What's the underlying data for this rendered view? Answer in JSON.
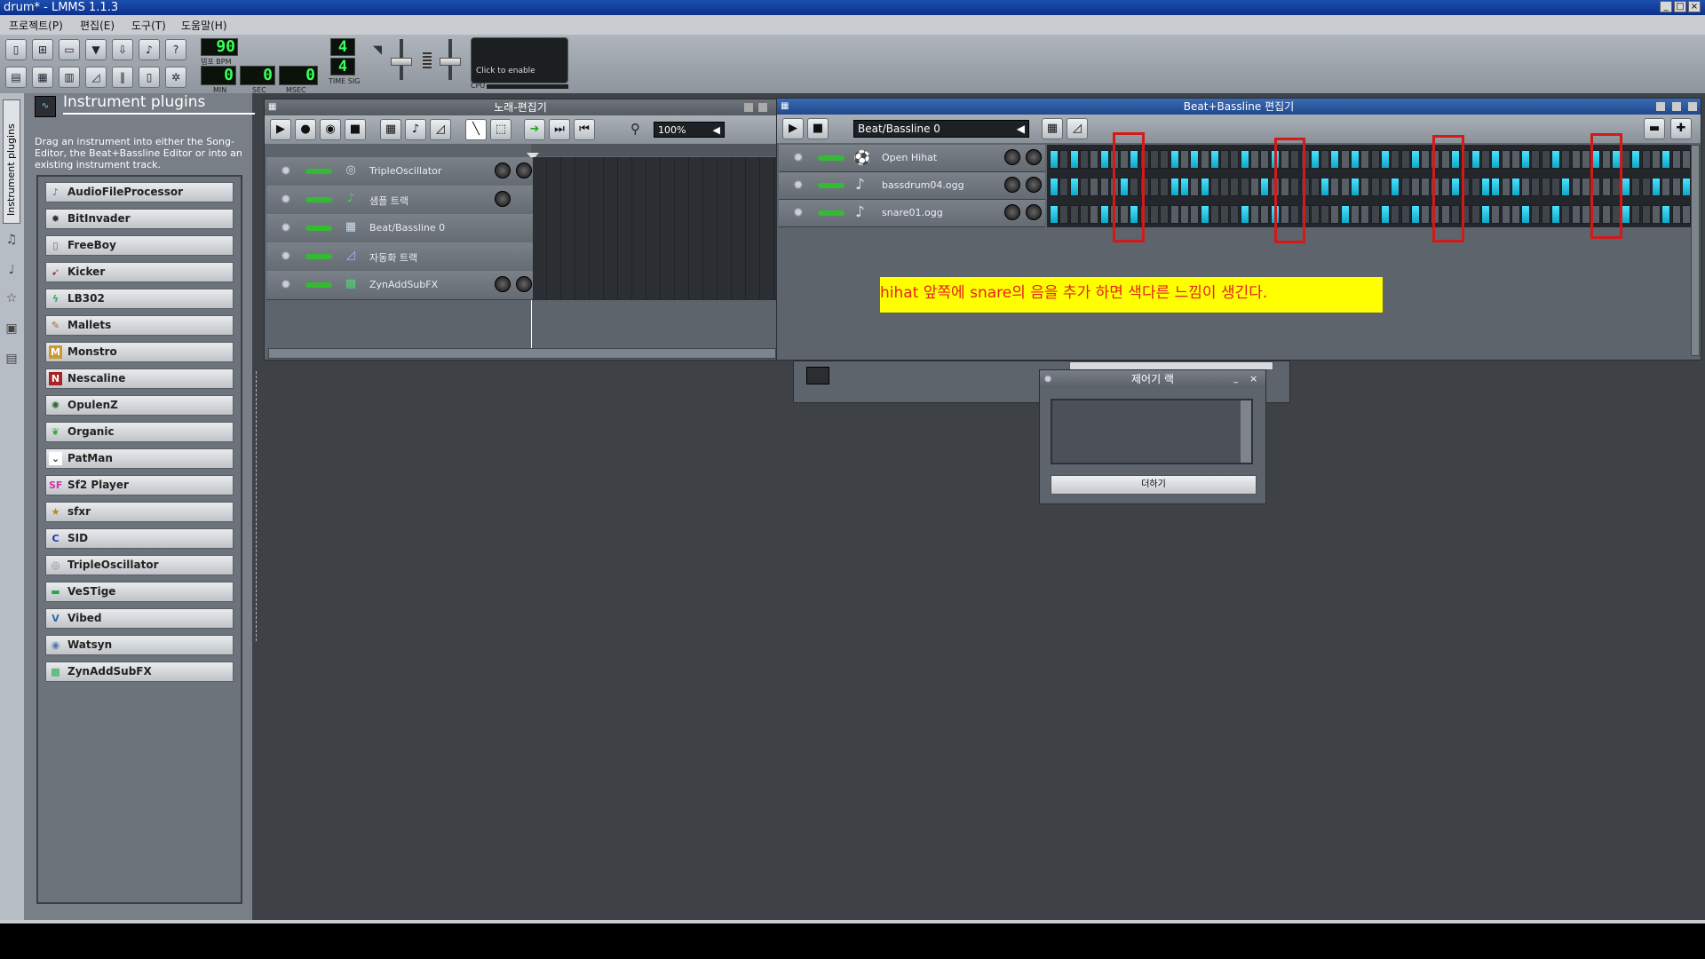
{
  "window": {
    "title": "drum* - LMMS 1.1.3"
  },
  "menu": [
    "프로젝트(P)",
    "편집(E)",
    "도구(T)",
    "도움말(H)"
  ],
  "toolbar": {
    "tempo": "90",
    "tempo_label": "템포 BPM",
    "min": "0",
    "sec": "0",
    "msec": "0",
    "min_label": "MIN",
    "sec_label": "SEC",
    "msec_label": "MSEC",
    "timesig_top": "4",
    "timesig_bottom": "4",
    "timesig_label": "TIME SIG",
    "cpu_text": "Click to enable",
    "cpu_label": "CPU"
  },
  "sidebar": {
    "tab_label": "Instrument plugins"
  },
  "instrument_panel": {
    "title": "Instrument plugins",
    "description": "Drag an instrument into either the Song-Editor, the Beat+Bassline Editor or into an existing instrument track.",
    "plugins": [
      {
        "label": "AudioFileProcessor",
        "icon": "waveform-icon"
      },
      {
        "label": "BitInvader",
        "icon": "bitinvader-icon"
      },
      {
        "label": "FreeBoy",
        "icon": "gameboy-icon"
      },
      {
        "label": "Kicker",
        "icon": "kicker-icon"
      },
      {
        "label": "LB302",
        "icon": "lb302-icon"
      },
      {
        "label": "Mallets",
        "icon": "mallets-icon"
      },
      {
        "label": "Monstro",
        "icon": "monstro-icon"
      },
      {
        "label": "Nescaline",
        "icon": "nescaline-icon"
      },
      {
        "label": "OpulenZ",
        "icon": "opulenz-icon"
      },
      {
        "label": "Organic",
        "icon": "organic-icon"
      },
      {
        "label": "PatMan",
        "icon": "patman-icon"
      },
      {
        "label": "Sf2 Player",
        "icon": "sf2-icon"
      },
      {
        "label": "sfxr",
        "icon": "sfxr-icon"
      },
      {
        "label": "SID",
        "icon": "sid-icon"
      },
      {
        "label": "TripleOscillator",
        "icon": "tripleosc-icon"
      },
      {
        "label": "VeSTige",
        "icon": "vestige-icon"
      },
      {
        "label": "Vibed",
        "icon": "vibed-icon"
      },
      {
        "label": "Watsyn",
        "icon": "watsyn-icon"
      },
      {
        "label": "ZynAddSubFX",
        "icon": "zyn-icon"
      }
    ]
  },
  "song_editor": {
    "title": "노래-편집기",
    "zoom": "100%",
    "tracks": [
      {
        "name": "TripleOscillator",
        "icon": "oscillator-icon"
      },
      {
        "name": "샘플 트랙",
        "icon": "sample-note-icon"
      },
      {
        "name": "Beat/Bassline 0",
        "icon": "beat-bassline-icon"
      },
      {
        "name": "자동화 트랙",
        "icon": "automation-icon"
      },
      {
        "name": "ZynAddSubFX",
        "icon": "zyn-icon"
      }
    ]
  },
  "beat_editor": {
    "title": "Beat+Bassline 편집기",
    "pattern": "Beat/Bassline 0",
    "tracks": [
      {
        "name": "Open Hihat",
        "steps": [
          1,
          0,
          1,
          0,
          0,
          1,
          0,
          0,
          1,
          0,
          0,
          0,
          1,
          0,
          1,
          0,
          1,
          0,
          0,
          1,
          0,
          0,
          1,
          0,
          0,
          0,
          1,
          0,
          1,
          0,
          1,
          0,
          0,
          1,
          0,
          0,
          1,
          0,
          0,
          0,
          1,
          0,
          1,
          0,
          1,
          0,
          0,
          1,
          0,
          0,
          1,
          0,
          0,
          0,
          1,
          0,
          1,
          0,
          1,
          0,
          0,
          1,
          0,
          0
        ]
      },
      {
        "name": "bassdrum04.ogg",
        "steps": [
          1,
          0,
          1,
          0,
          0,
          0,
          0,
          1,
          0,
          0,
          0,
          0,
          1,
          1,
          0,
          1,
          0,
          0,
          0,
          0,
          0,
          1,
          0,
          0,
          0,
          0,
          0,
          1,
          0,
          0,
          1,
          0,
          0,
          0,
          1,
          0,
          0,
          0,
          0,
          0,
          1,
          0,
          0,
          1,
          1,
          0,
          1,
          0,
          0,
          0,
          0,
          1,
          0,
          0,
          0,
          0,
          0,
          1,
          0,
          0,
          1,
          0,
          0,
          1
        ]
      },
      {
        "name": "snare01.ogg",
        "steps": [
          1,
          0,
          0,
          0,
          0,
          1,
          0,
          0,
          1,
          0,
          0,
          0,
          0,
          0,
          0,
          1,
          0,
          0,
          0,
          1,
          0,
          0,
          1,
          0,
          0,
          0,
          0,
          0,
          0,
          1,
          0,
          0,
          0,
          1,
          0,
          0,
          1,
          0,
          0,
          0,
          0,
          0,
          0,
          1,
          0,
          0,
          0,
          1,
          0,
          0,
          1,
          0,
          0,
          0,
          0,
          0,
          0,
          1,
          0,
          0,
          0,
          1,
          0,
          0
        ]
      }
    ]
  },
  "annotation": {
    "text": "hihat 앞쪽에 snare의 음을 추가 하면 색다른 느낌이 생긴다."
  },
  "effects_window": {
    "title": "제어기 랙",
    "add_button": "더하기"
  },
  "colors": {
    "step_on": "#28c8e8",
    "highlight": "#d21a1a",
    "note_bg": "#ffff00",
    "note_text": "#e42020"
  }
}
